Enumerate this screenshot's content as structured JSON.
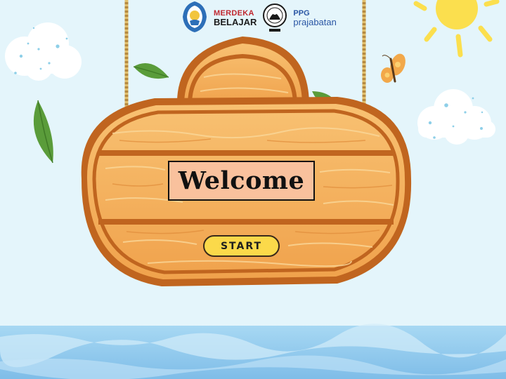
{
  "logos": {
    "merdeka_line1": "MERDEKA",
    "merdeka_line2": "BELAJAR",
    "ppg": "PPG",
    "prajabatan": "prajabatan"
  },
  "sign": {
    "title": "Welcome",
    "start_label": "START"
  },
  "colors": {
    "sky": "#e4f5fb",
    "wood_light": "#f6b964",
    "wood_dark": "#c0651f",
    "welcome_box": "#f9c19d",
    "start_button": "#fbd94a",
    "water": "#8ec8ec"
  }
}
